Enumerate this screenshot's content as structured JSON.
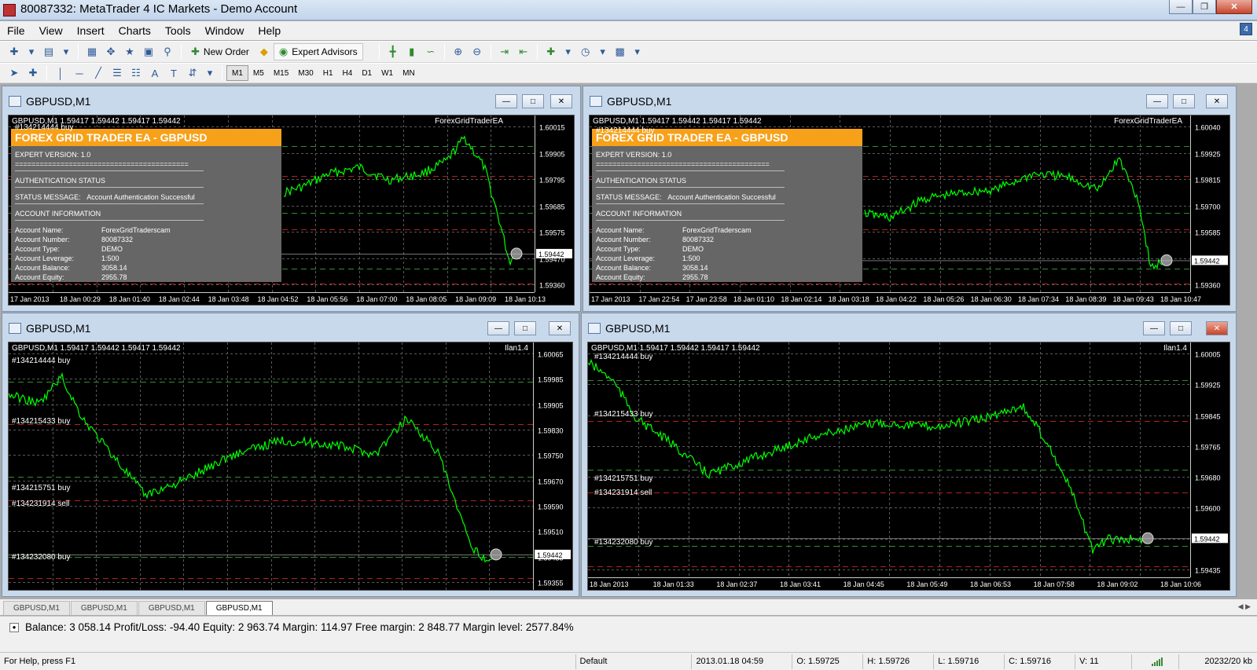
{
  "app": {
    "title": "80087332: MetaTrader 4 IC Markets - Demo Account",
    "mdi_badge": "4"
  },
  "menu": [
    "File",
    "View",
    "Insert",
    "Charts",
    "Tools",
    "Window",
    "Help"
  ],
  "toolbar": {
    "new_order": "New Order",
    "expert_advisors": "Expert Advisors",
    "timeframes": [
      "M1",
      "M5",
      "M15",
      "M30",
      "H1",
      "H4",
      "D1",
      "W1",
      "MN"
    ],
    "active_timeframe": "M1"
  },
  "windows": [
    {
      "title": "GBPUSD,M1",
      "ohlc": "GBPUSD,M1  1.59417 1.59442 1.59417 1.59442",
      "ea": "ForexGridTraderEA",
      "price_ticks": [
        "1.60015",
        "1.59905",
        "1.59795",
        "1.59685",
        "1.59575",
        "1.59470",
        "1.59360"
      ],
      "current_price": "1.59442",
      "time_ticks": [
        "17 Jan 2013",
        "18 Jan 00:29",
        "18 Jan 01:40",
        "18 Jan 02:44",
        "18 Jan 03:48",
        "18 Jan 04:52",
        "18 Jan 05:56",
        "18 Jan 07:00",
        "18 Jan 08:05",
        "18 Jan 09:09",
        "18 Jan 10:13"
      ],
      "order_labels": [
        {
          "text": "#134214444 buy"
        }
      ],
      "panel": {
        "header": "FOREX GRID TRADER EA - GBPUSD",
        "version": "EXPERT VERSION: 1.0",
        "divider": "==========================================",
        "auth_title": "AUTHENTICATION STATUS",
        "status_label": "STATUS MESSAGE:",
        "status_value": "Account Authentication Successful",
        "account_title": "ACCOUNT INFORMATION",
        "rows": [
          {
            "k": "Account Name:",
            "v": "ForexGridTraderscam"
          },
          {
            "k": "Account Number:",
            "v": "80087332"
          },
          {
            "k": "Account Type:",
            "v": "DEMO"
          },
          {
            "k": "Account Leverage:",
            "v": "1:500"
          },
          {
            "k": "Account Balance:",
            "v": "3058.14"
          },
          {
            "k": "Account Equity:",
            "v": "2955.78"
          }
        ]
      }
    },
    {
      "title": "GBPUSD,M1",
      "ohlc": "GBPUSD,M1  1.59417 1.59442 1.59417 1.59442",
      "ea": "ForexGridTraderEA",
      "price_ticks": [
        "1.60040",
        "1.59925",
        "1.59815",
        "1.59700",
        "1.59585",
        "1.59470",
        "1.59360"
      ],
      "current_price": "1.59442",
      "time_ticks": [
        "17 Jan 2013",
        "17 Jan 22:54",
        "17 Jan 23:58",
        "18 Jan 01:10",
        "18 Jan 02:14",
        "18 Jan 03:18",
        "18 Jan 04:22",
        "18 Jan 05:26",
        "18 Jan 06:30",
        "18 Jan 07:34",
        "18 Jan 08:39",
        "18 Jan 09:43",
        "18 Jan 10:47"
      ],
      "order_labels": [
        {
          "text": "#134214444 buy"
        }
      ],
      "panel": {
        "header": "FOREX GRID TRADER EA - GBPUSD",
        "version": "EXPERT VERSION: 1.0",
        "divider": "==========================================",
        "auth_title": "AUTHENTICATION STATUS",
        "status_label": "STATUS MESSAGE:",
        "status_value": "Account Authentication Successful",
        "account_title": "ACCOUNT INFORMATION",
        "rows": [
          {
            "k": "Account Name:",
            "v": "ForexGridTraderscam"
          },
          {
            "k": "Account Number:",
            "v": "80087332"
          },
          {
            "k": "Account Type:",
            "v": "DEMO"
          },
          {
            "k": "Account Leverage:",
            "v": "1:500"
          },
          {
            "k": "Account Balance:",
            "v": "3058.14"
          },
          {
            "k": "Account Equity:",
            "v": "2955.78"
          }
        ]
      }
    },
    {
      "title": "GBPUSD,M1",
      "ohlc": "GBPUSD,M1  1.59417 1.59442 1.59417 1.59442",
      "ea": "Ilan1.4",
      "price_ticks": [
        "1.60065",
        "1.59985",
        "1.59905",
        "1.59830",
        "1.59750",
        "1.59670",
        "1.59590",
        "1.59510",
        "1.59435",
        "1.59355"
      ],
      "current_price": "1.59442",
      "time_ticks": [],
      "order_labels": [
        {
          "text": "#134214444 buy"
        },
        {
          "text": "#134215433 buy"
        },
        {
          "text": "#134215751 buy"
        },
        {
          "text": "#134231914 sell"
        },
        {
          "text": "#134232080 buy"
        }
      ]
    },
    {
      "title": "GBPUSD,M1",
      "ohlc": "GBPUSD,M1  1.59417 1.59442 1.59417 1.59442",
      "ea": "Ilan1.4",
      "price_ticks": [
        "1.60005",
        "1.59925",
        "1.59845",
        "1.59765",
        "1.59680",
        "1.59600",
        "1.59520",
        "1.59435"
      ],
      "current_price": "1.59442",
      "time_ticks": [
        "18 Jan 2013",
        "18 Jan 01:33",
        "18 Jan 02:37",
        "18 Jan 03:41",
        "18 Jan 04:45",
        "18 Jan 05:49",
        "18 Jan 06:53",
        "18 Jan 07:58",
        "18 Jan 09:02",
        "18 Jan 10:06"
      ],
      "order_labels": [
        {
          "text": "#134214444 buy"
        },
        {
          "text": "#134215433 buy"
        },
        {
          "text": "#134215751 buy"
        },
        {
          "text": "#134231914 sell"
        },
        {
          "text": "#134232080 buy"
        }
      ]
    }
  ],
  "tabs": [
    "GBPUSD,M1",
    "GBPUSD,M1",
    "GBPUSD,M1",
    "GBPUSD,M1"
  ],
  "active_tab": 3,
  "balance_line": "Balance: 3 058.14  Profit/Loss: -94.40  Equity: 2 963.74  Margin: 114.97  Free margin: 2 848.77  Margin level: 2577.84%",
  "statusbar": {
    "help": "For Help, press F1",
    "profile": "Default",
    "datetime": "2013.01.18 04:59",
    "open": "O: 1.59725",
    "high": "H: 1.59726",
    "low": "L: 1.59716",
    "close": "C: 1.59716",
    "volume": "V: 11",
    "traffic": "20232/20 kb"
  },
  "colors": {
    "price_line": "#00ff00",
    "grid": "#6b6b6b",
    "panel_header": "#f7a11a",
    "bg": "#000000"
  }
}
